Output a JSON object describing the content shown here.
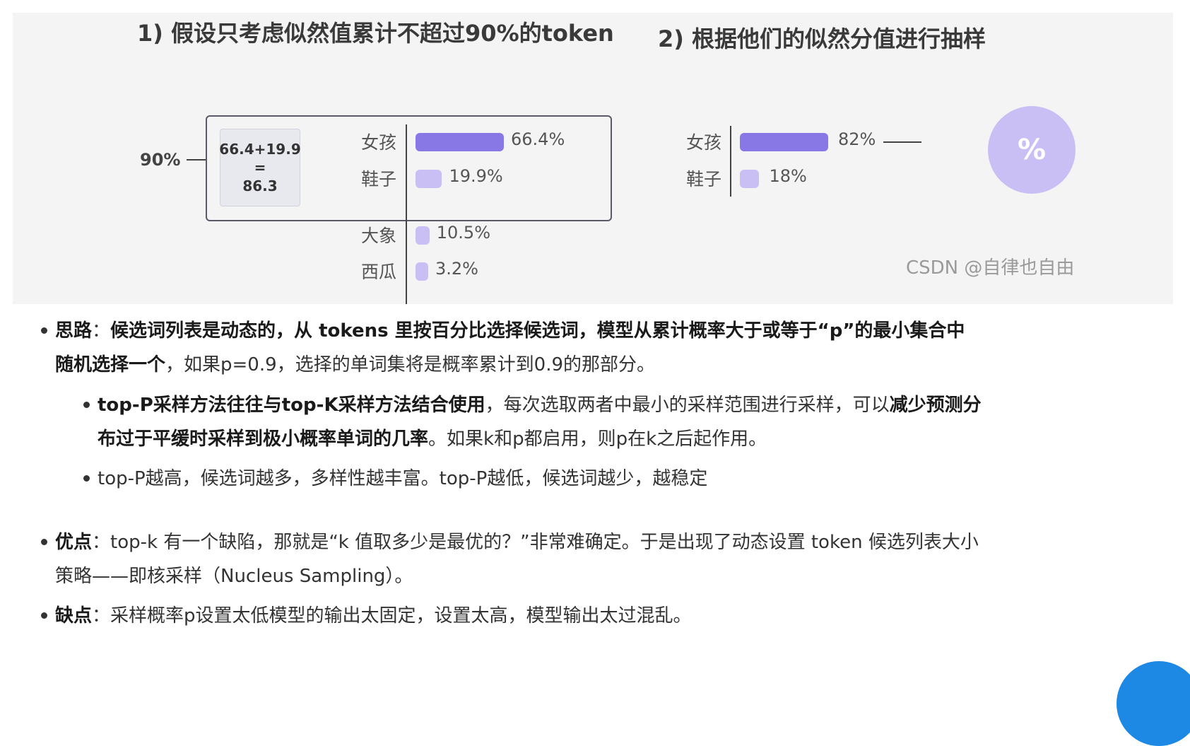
{
  "figure": {
    "heading1": "1) 假设只考虑似然值累计不超过90%的token",
    "heading2": "2) 根据他们的似然分值进行抽样",
    "threshold_label": "90%",
    "sum_box": {
      "line1": "66.4+19.9",
      "line2": "=",
      "line3": "86.3"
    },
    "left_chart": [
      {
        "word": "女孩",
        "pct_label": "66.4%",
        "value": 66.4
      },
      {
        "word": "鞋子",
        "pct_label": "19.9%",
        "value": 19.9
      },
      {
        "word": "大象",
        "pct_label": "10.5%",
        "value": 10.5
      },
      {
        "word": "西瓜",
        "pct_label": "3.2%",
        "value": 3.2
      }
    ],
    "right_chart": [
      {
        "word": "女孩",
        "pct_label": "82%",
        "value": 82
      },
      {
        "word": "鞋子",
        "pct_label": "18%",
        "value": 18
      }
    ],
    "circle_symbol": "%",
    "watermark": "CSDN @自律也自由",
    "colors": {
      "bar_dark": "#8878e6",
      "bar_light": "#c9bff5",
      "panel_bg": "#f4f4f4"
    }
  },
  "bullets": {
    "b1": {
      "bold_label": "思路",
      "sep": "：",
      "bold_text": "候选词列表是动态的，从 tokens 里按百分比选择候选词，模型从累计概率大于或等于“p”的最小集合中",
      "bold_text2": "随机选择一个",
      "rest": "，如果p=0.9，选择的单词集将是概率累计到0.9的那部分。"
    },
    "s1": {
      "bold1": "top-P采样方法往往与top-K采样方法结合使用",
      "text1": "，每次选取两者中最小的采样范围进行采样，可以",
      "bold2": "减少预测分",
      "bold3": "布过于平缓时采样到极小概率单词的几率",
      "text2": "。如果k和p都启用，则p在k之后起作用。"
    },
    "s2": {
      "text": "top-P越高，候选词越多，多样性越丰富。top-P越低，候选词越少，越稳定"
    },
    "b2": {
      "bold_label": "优点",
      "sep": "：",
      "text1": "top-k 有一个缺陷，那就是“k 值取多少是最优的？”非常难确定。于是出现了动态设置 token 候选列表大小",
      "text2": "策略——即核采样（Nucleus Sampling）。"
    },
    "b3": {
      "bold_label": "缺点",
      "sep": "：",
      "text": "采样概率p设置太低模型的输出太固定，设置太高，模型输出太过混乱。"
    }
  }
}
